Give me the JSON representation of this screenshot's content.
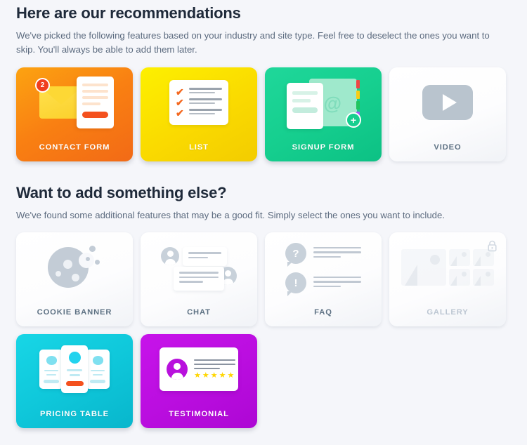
{
  "recommendations": {
    "title": "Here are our recommendations",
    "subtitle": "We've picked the following features based on your industry and site type. Feel free to deselect the ones you want to skip. You'll always be able to add them later.",
    "cards": [
      {
        "label": "CONTACT FORM",
        "icon": "contact-form-icon",
        "selected": true,
        "accent": "#f98012",
        "badge_count": "2"
      },
      {
        "label": "LIST",
        "icon": "checklist-icon",
        "selected": true,
        "accent": "#fada00"
      },
      {
        "label": "SIGNUP FORM",
        "icon": "signup-form-icon",
        "selected": true,
        "accent": "#16cf8f",
        "add_glyph": "+"
      },
      {
        "label": "VIDEO",
        "icon": "video-play-icon",
        "selected": false,
        "accent": "#b9c4ce"
      }
    ]
  },
  "additional": {
    "title": "Want to add something else?",
    "subtitle": "We've found some additional features that may be a good fit. Simply select the ones you want to include.",
    "cards": [
      {
        "label": "COOKIE BANNER",
        "icon": "cookie-icon",
        "selected": false,
        "locked": false
      },
      {
        "label": "CHAT",
        "icon": "chat-bubbles-icon",
        "selected": false,
        "locked": false
      },
      {
        "label": "FAQ",
        "icon": "faq-bubbles-icon",
        "selected": false,
        "locked": false,
        "question_glyph": "?",
        "exclaim_glyph": "!"
      },
      {
        "label": "GALLERY",
        "icon": "gallery-images-icon",
        "selected": false,
        "locked": true,
        "lock_icon": "lock-icon"
      },
      {
        "label": "PRICING TABLE",
        "icon": "pricing-table-icon",
        "selected": true,
        "accent": "#0fc7da"
      },
      {
        "label": "TESTIMONIAL",
        "icon": "testimonial-icon",
        "selected": true,
        "accent": "#bb0ee0",
        "stars": "★★★★★"
      }
    ]
  }
}
